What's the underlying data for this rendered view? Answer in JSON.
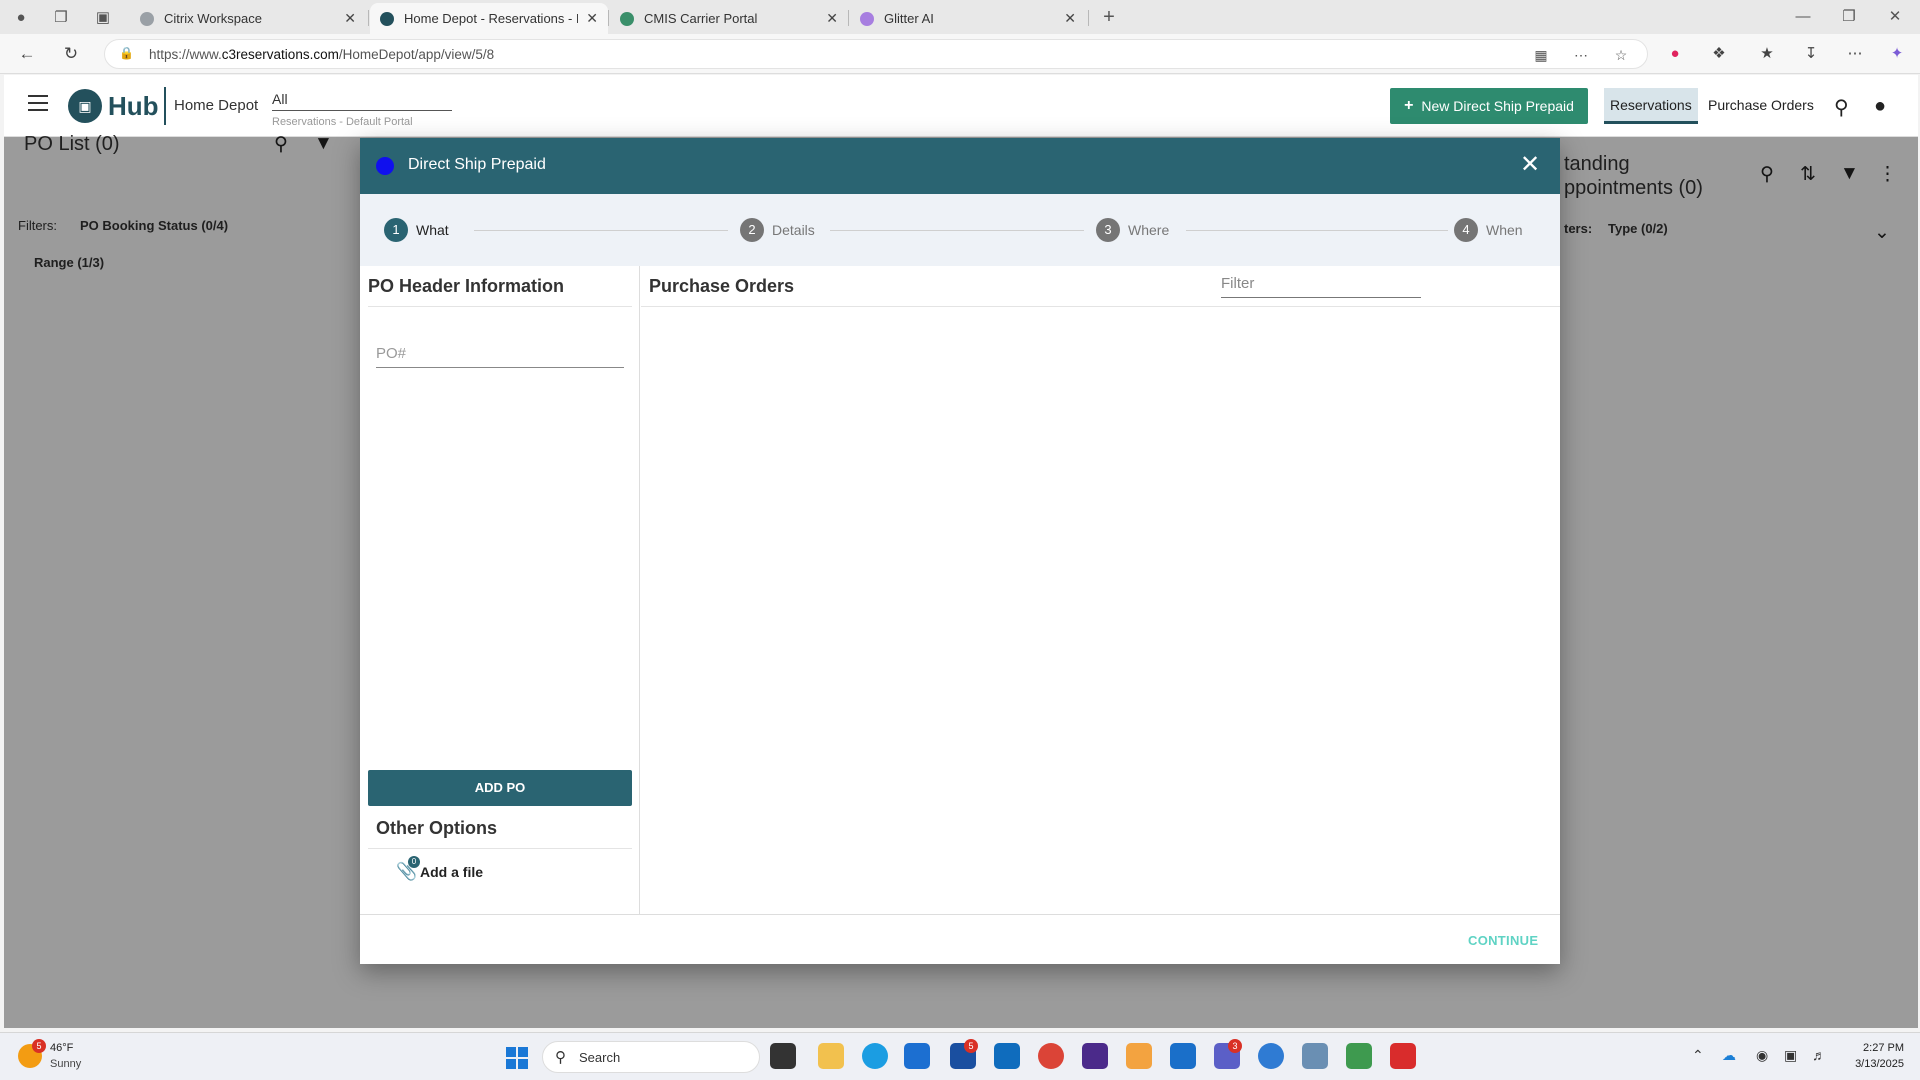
{
  "browser": {
    "tabs": [
      {
        "title": "Citrix Workspace",
        "active": false,
        "favicon_color": "#9aa0a6"
      },
      {
        "title": "Home Depot - Reservations - Def",
        "active": true,
        "favicon_color": "#23505c"
      },
      {
        "title": "CMIS Carrier Portal",
        "active": false,
        "favicon_color": "#3a8f6a"
      },
      {
        "title": "Glitter AI",
        "active": false,
        "favicon_color": "#a77ee0"
      }
    ],
    "url_prefix": "https://www.",
    "url_domain": "c3reservations.com",
    "url_path": "/HomeDepot/app/view/5/8"
  },
  "app": {
    "logo_text": "Hub",
    "org_name": "Home Depot",
    "portal_value": "All",
    "portal_hint": "Reservations - Default Portal",
    "new_button_label": "New Direct Ship Prepaid",
    "nav_reservations": "Reservations",
    "nav_purchase_orders": "Purchase Orders"
  },
  "background": {
    "po_list_title": "PO List (0)",
    "filters_label": "Filters:",
    "filter_booking_status": "PO Booking Status (0/4)",
    "filter_range": "Range (1/3)",
    "standing_title_line1": "tanding",
    "standing_title_line2": "ppointments (0)",
    "standing_filters_label": "ters:",
    "standing_filter_type": "Type (0/2)"
  },
  "modal": {
    "title": "Direct Ship Prepaid",
    "steps": [
      {
        "num": "1",
        "label": "What",
        "active": true
      },
      {
        "num": "2",
        "label": "Details",
        "active": false
      },
      {
        "num": "3",
        "label": "Where",
        "active": false
      },
      {
        "num": "4",
        "label": "When",
        "active": false
      }
    ],
    "po_header_title": "PO Header Information",
    "po_placeholder": "PO#",
    "add_po_label": "ADD PO",
    "other_options_title": "Other Options",
    "file_count": "0",
    "add_file_label": "Add a file",
    "purchase_orders_title": "Purchase Orders",
    "filter_placeholder": "Filter",
    "continue_label": "CONTINUE"
  },
  "taskbar": {
    "weather_badge": "5",
    "weather_temp": "46°F",
    "weather_desc": "Sunny",
    "search_label": "Search",
    "badge_outlook": "5",
    "badge_teams": "3",
    "time": "2:27 PM",
    "date": "3/13/2025"
  }
}
